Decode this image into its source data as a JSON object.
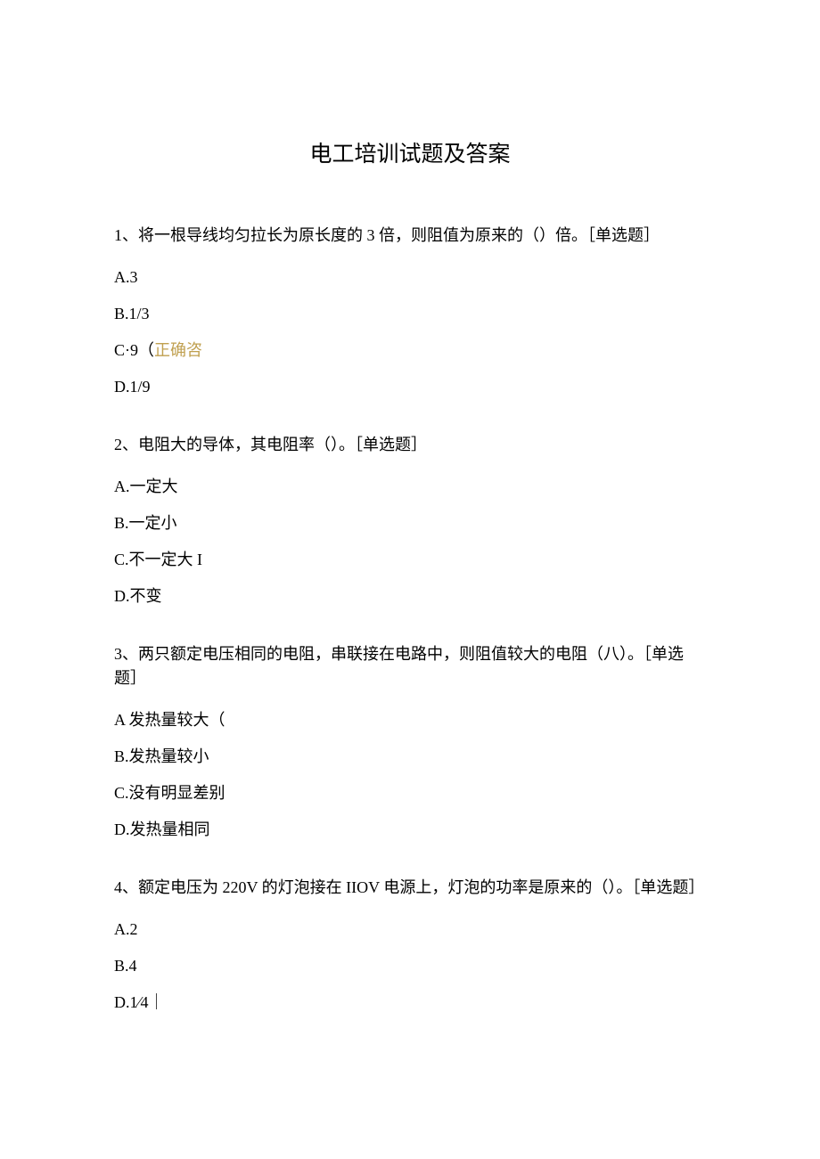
{
  "title": "电工培训试题及答案",
  "q1": {
    "stem": "1、将一根导线均匀拉长为原长度的 3 倍，则阻值为原来的（）倍。［单选题］",
    "optA": "A.3",
    "optB": "B.1/3",
    "optC_prefix": "C·9（",
    "optC_correct": "正确咨",
    "optD": "D.1/9"
  },
  "q2": {
    "stem": "2、电阻大的导体，其电阻率（）。［单选题］",
    "optA": "A.一定大",
    "optB": "B.一定小",
    "optC": "C.不一定大 I",
    "optD": "D.不变"
  },
  "q3": {
    "stem": "3、两只额定电压相同的电阻，串联接在电路中，则阻值较大的电阻（八）。［单选题］",
    "optA": "A 发热量较大（",
    "optB": "B.发热量较小",
    "optC": "C.没有明显差别",
    "optD": "D.发热量相同"
  },
  "q4": {
    "stem": "4、额定电压为 220V 的灯泡接在 IIOV 电源上，灯泡的功率是原来的（）。［单选题］",
    "optA": "A.2",
    "optB": "B.4",
    "optD": "D.1⁄4｜"
  }
}
